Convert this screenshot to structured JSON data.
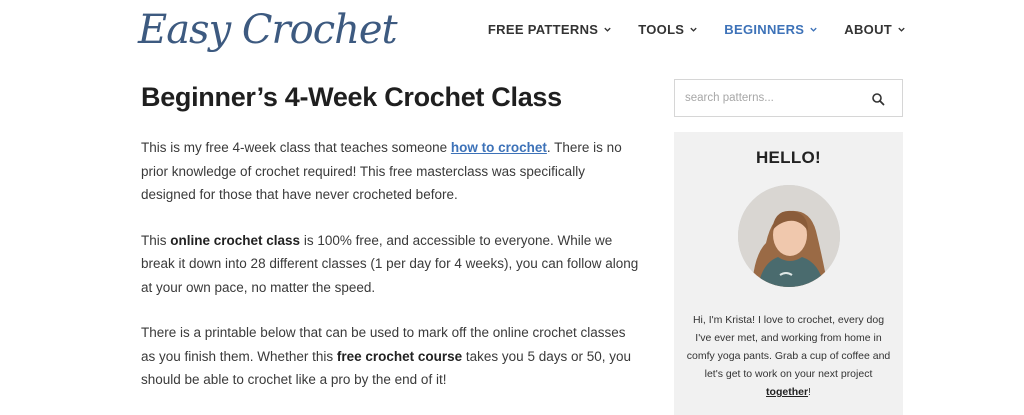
{
  "site": {
    "logo_text": "Easy Crochet"
  },
  "nav": {
    "items": [
      {
        "label": "FREE PATTERNS"
      },
      {
        "label": "TOOLS"
      },
      {
        "label": "BEGINNERS"
      },
      {
        "label": "ABOUT"
      }
    ],
    "active_index": 2,
    "active_color": "#3d72b8"
  },
  "article": {
    "title": "Beginner’s 4-Week Crochet Class",
    "p1": {
      "before": "This is my free 4-week class that teaches someone ",
      "link": "how to crochet",
      "after": ". There is no prior knowledge of crochet required! This free masterclass was specifically designed for those that have never crocheted before."
    },
    "p2": {
      "before": "This ",
      "bold": "online crochet class",
      "after": " is 100% free, and accessible to everyone. While we break it down into 28 different classes (1 per day for 4 weeks), you can follow along at your own pace, no matter the speed."
    },
    "p3": {
      "before": "There is a printable below that can be used to mark off the online crochet classes as you finish them. Whether this ",
      "bold": "free crochet course",
      "after": " takes you 5 days or 50, you should be able to crochet like a pro by the end of it!"
    }
  },
  "sidebar": {
    "search": {
      "placeholder": "search patterns...",
      "value": "",
      "icon": "search-icon"
    },
    "hello": {
      "title": "HELLO!",
      "bio_before": "Hi, I'm Krista! I love to crochet, every dog I've ever met, and working from home in comfy yoga pants. Grab a cup of coffee and let's get to work on your next project ",
      "bio_link": "together",
      "bio_after": "!"
    }
  },
  "colors": {
    "brand": "#3d5a80",
    "link": "#3d72b8",
    "card_bg": "#f1f1f1"
  }
}
